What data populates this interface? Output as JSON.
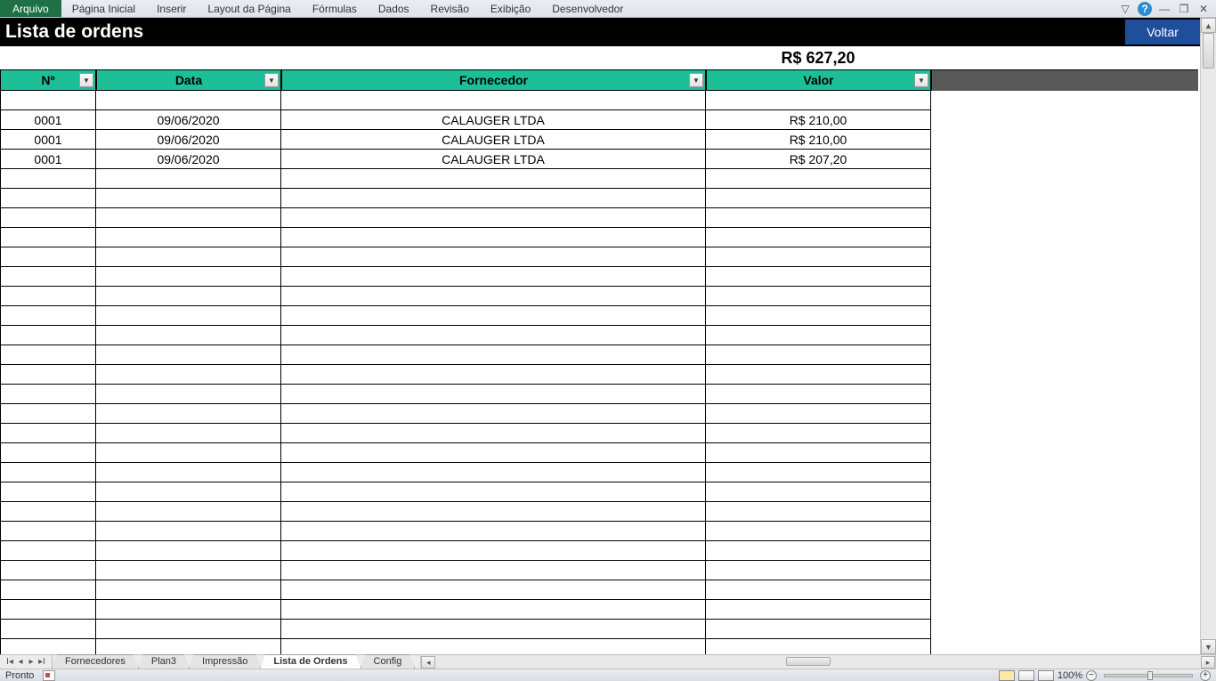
{
  "ribbon": {
    "file": "Arquivo",
    "items": [
      "Página Inicial",
      "Inserir",
      "Layout da Página",
      "Fórmulas",
      "Dados",
      "Revisão",
      "Exibição",
      "Desenvolvedor"
    ]
  },
  "header": {
    "title": "Lista de ordens",
    "back_label": "Voltar"
  },
  "total": "R$ 627,20",
  "columns": {
    "no": "Nº",
    "date": "Data",
    "supplier": "Fornecedor",
    "value": "Valor"
  },
  "rows": [
    {
      "no": "0001",
      "date": "09/06/2020",
      "supplier": "CALAUGER LTDA",
      "value": "R$ 210,00"
    },
    {
      "no": "0001",
      "date": "09/06/2020",
      "supplier": "CALAUGER LTDA",
      "value": "R$ 210,00"
    },
    {
      "no": "0001",
      "date": "09/06/2020",
      "supplier": "CALAUGER LTDA",
      "value": "R$ 207,20"
    }
  ],
  "empty_rows": 26,
  "tabs": {
    "items": [
      "Fornecedores",
      "Plan3",
      "Impressão",
      "Lista de Ordens",
      "Config"
    ],
    "active": "Lista de Ordens"
  },
  "status": {
    "ready": "Pronto",
    "zoom": "100%"
  }
}
